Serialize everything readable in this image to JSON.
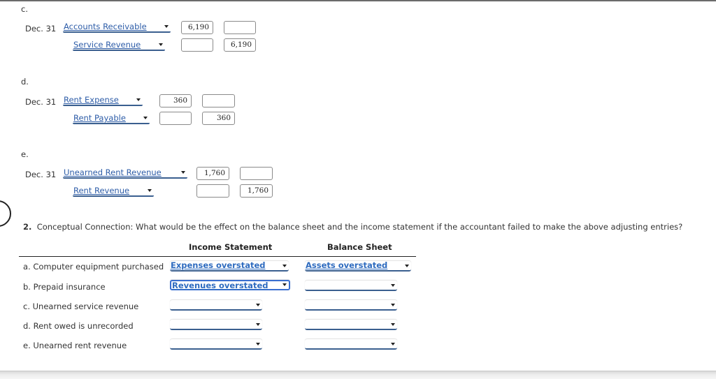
{
  "part1": {
    "entries": [
      {
        "letter": "c.",
        "date": "Dec. 31",
        "debit_account": "Accounts Receivable",
        "credit_account": "Service Revenue",
        "debit_amount": "6,190",
        "credit_amount": "6,190"
      },
      {
        "letter": "d.",
        "date": "Dec. 31",
        "debit_account": "Rent Expense",
        "credit_account": "Rent Payable",
        "debit_amount": "360",
        "credit_amount": "360"
      },
      {
        "letter": "e.",
        "date": "Dec. 31",
        "debit_account": "Unearned Rent Revenue",
        "credit_account": "Rent Revenue",
        "debit_amount": "1,760",
        "credit_amount": "1,760"
      }
    ]
  },
  "part2": {
    "number": "2.",
    "question": "Conceptual Connection: What would be the effect on the balance sheet and the income statement if the accountant failed to make the above adjusting entries?",
    "headers": {
      "income_statement": "Income Statement",
      "balance_sheet": "Balance Sheet"
    },
    "rows": [
      {
        "label": "a. Computer equipment purchased",
        "income": "Expenses overstated",
        "balance": "Assets overstated"
      },
      {
        "label": "b. Prepaid insurance",
        "income": "Revenues overstated",
        "balance": ""
      },
      {
        "label": "c. Unearned service revenue",
        "income": "",
        "balance": ""
      },
      {
        "label": "d. Rent owed is unrecorded",
        "income": "",
        "balance": ""
      },
      {
        "label": "e. Unearned rent revenue",
        "income": "",
        "balance": ""
      }
    ]
  }
}
